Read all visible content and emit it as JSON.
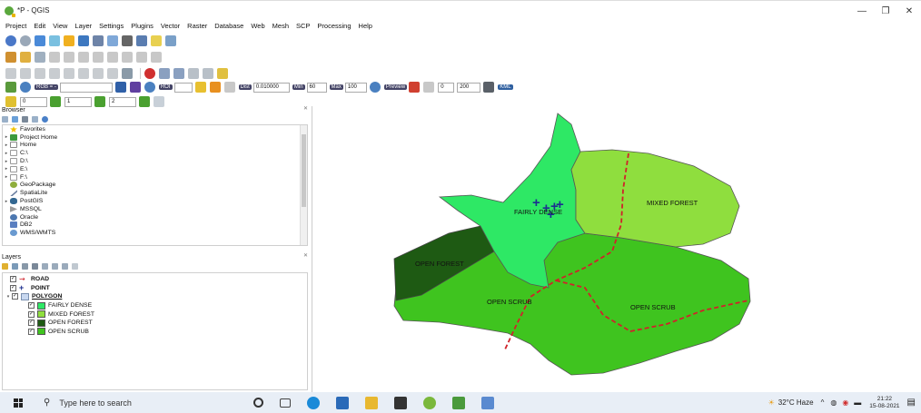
{
  "window": {
    "title": "*P - QGIS",
    "controls": [
      "—",
      "❐",
      "✕"
    ]
  },
  "menu": [
    "Project",
    "Edit",
    "View",
    "Layer",
    "Settings",
    "Plugins",
    "Vector",
    "Raster",
    "Database",
    "Web",
    "Mesh",
    "SCP",
    "Processing",
    "Help"
  ],
  "scp_toolbar": {
    "rgb_value": "RGB = -",
    "roi_label": "ROI",
    "dist_label": "Dist",
    "dist_value": "0.010000",
    "min_label": "Min",
    "min_value": "60",
    "max_label": "Max",
    "max_value": "100",
    "preview_label": "Preview",
    "preview_field_1": "0",
    "preview_field_2": "200",
    "kml_label": "KML"
  },
  "band_toolbar": {
    "field_1": "0",
    "field_2": "1",
    "field_3": "2"
  },
  "browser": {
    "title": "Browser",
    "items": [
      {
        "label": "Favorites",
        "icon": "star-icon",
        "color": "#f2c200",
        "arrow": ""
      },
      {
        "label": "Project Home",
        "icon": "folder-icon",
        "color": "#3c9a3c",
        "arrow": "▸"
      },
      {
        "label": "Home",
        "icon": "folder-icon",
        "color": "#c9c9c9",
        "arrow": "▸"
      },
      {
        "label": "C:\\",
        "icon": "folder-icon",
        "color": "#dcdcdc",
        "arrow": "▸"
      },
      {
        "label": "D:\\",
        "icon": "folder-icon",
        "color": "#dcdcdc",
        "arrow": "▸"
      },
      {
        "label": "E:\\",
        "icon": "folder-icon",
        "color": "#dcdcdc",
        "arrow": "▸"
      },
      {
        "label": "F:\\",
        "icon": "folder-icon",
        "color": "#dcdcdc",
        "arrow": "▸"
      },
      {
        "label": "GeoPackage",
        "icon": "geopackage-icon",
        "color": "#8fae3c",
        "arrow": ""
      },
      {
        "label": "SpatiaLite",
        "icon": "spatialite-icon",
        "color": "#6b7fa0",
        "arrow": ""
      },
      {
        "label": "PostGIS",
        "icon": "postgis-icon",
        "color": "#336791",
        "arrow": "▸"
      },
      {
        "label": "MSSQL",
        "icon": "mssql-icon",
        "color": "#9a9a9a",
        "arrow": ""
      },
      {
        "label": "Oracle",
        "icon": "oracle-icon",
        "color": "#4d78b0",
        "arrow": ""
      },
      {
        "label": "DB2",
        "icon": "db2-icon",
        "color": "#5a7fc0",
        "arrow": ""
      },
      {
        "label": "WMS/WMTS",
        "icon": "wms-icon",
        "color": "#6a9ad0",
        "arrow": ""
      }
    ]
  },
  "layers": {
    "title": "Layers",
    "items": [
      {
        "label": "ROAD",
        "indent": 0,
        "bold": true,
        "symbol": "road"
      },
      {
        "label": "POINT",
        "indent": 0,
        "bold": true,
        "symbol": "point"
      },
      {
        "label": "POLYGON",
        "indent": 0,
        "bold": true,
        "symbol": "polygon",
        "underline": true
      },
      {
        "label": "FAIRLY DENSE",
        "indent": 1,
        "bold": false,
        "symbol": "swatch",
        "color": "#2ee865"
      },
      {
        "label": "MIXED FOREST",
        "indent": 1,
        "bold": false,
        "symbol": "swatch",
        "color": "#8fde3e"
      },
      {
        "label": "OPEN FOREST",
        "indent": 1,
        "bold": false,
        "symbol": "swatch",
        "color": "#1e5a13"
      },
      {
        "label": "OPEN SCRUB",
        "indent": 1,
        "bold": false,
        "symbol": "swatch",
        "color": "#3fc41f"
      }
    ]
  },
  "map": {
    "labels": {
      "fairly_dense": "FAIRLY DENSE",
      "mixed_forest": "MIXED FOREST",
      "open_forest": "OPEN FOREST",
      "open_scrub_left": "OPEN SCRUB",
      "open_scrub_right": "OPEN SCRUB"
    },
    "colors": {
      "fairly_dense": "#2ee865",
      "mixed_forest": "#8fde3e",
      "open_forest": "#1e5a13",
      "open_scrub": "#3fc41f",
      "road": "#d0222a",
      "point": "#1c2f8f"
    }
  },
  "taskbar": {
    "search_placeholder": "Type here to search",
    "weather": "32°C Haze",
    "time": "21:22",
    "date": "15-08-2021"
  }
}
